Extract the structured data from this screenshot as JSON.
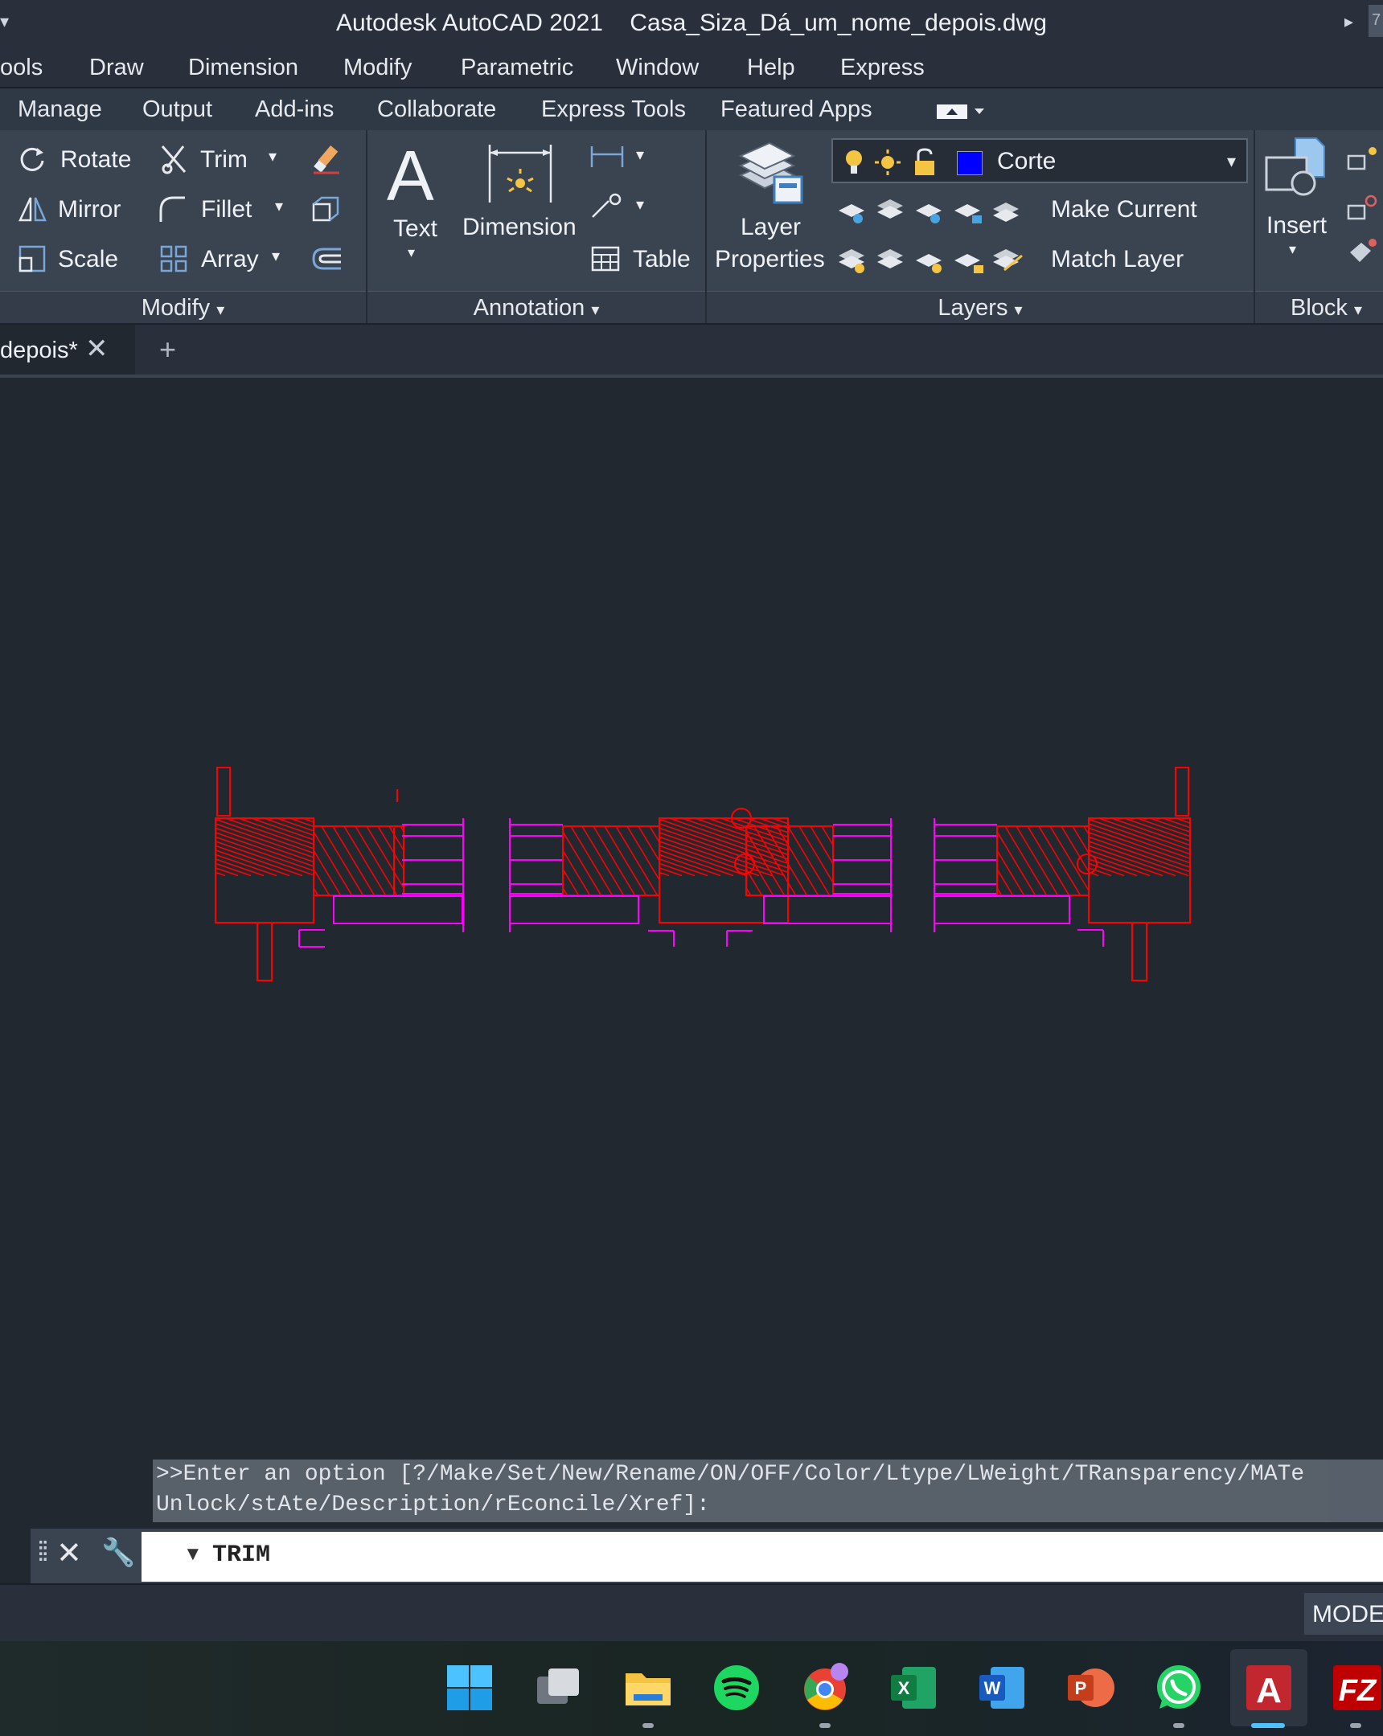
{
  "titlebar": {
    "title": "Autodesk AutoCAD 2021    Casa_Siza_Dá_um_nome_depois.dwg",
    "edge_text": "7"
  },
  "menubar": {
    "items": [
      "ools",
      "Draw",
      "Dimension",
      "Modify",
      "Parametric",
      "Window",
      "Help",
      "Express"
    ]
  },
  "ribbon_tabs": {
    "items": [
      "Manage",
      "Output",
      "Add-ins",
      "Collaborate",
      "Express Tools",
      "Featured Apps"
    ]
  },
  "ribbon": {
    "modify": {
      "rotate": "Rotate",
      "trim": "Trim",
      "mirror": "Mirror",
      "fillet": "Fillet",
      "scale": "Scale",
      "array": "Array",
      "footer": "Modify"
    },
    "annotation": {
      "text": "Text",
      "dimension": "Dimension",
      "table": "Table",
      "footer": "Annotation"
    },
    "layers": {
      "layer_properties_1": "Layer",
      "layer_properties_2": "Properties",
      "current_layer": "Corte",
      "layer_color": "#0000ff",
      "make_current": "Make Current",
      "match_layer": "Match Layer",
      "footer": "Layers"
    },
    "block": {
      "insert": "Insert",
      "footer": "Block"
    }
  },
  "doc_tab": {
    "label": "depois*"
  },
  "command": {
    "history_1": ">>Enter an option [?/Make/Set/New/Rename/ON/OFF/Color/Ltype/LWeight/TRansparency/MATe",
    "history_2": "Unlock/stAte/Description/rEconcile/Xref]:",
    "input_value": "TRIM"
  },
  "status": {
    "model": "MODEL"
  },
  "taskbar": {
    "apps": [
      "start-icon",
      "task-view-icon",
      "file-explorer-icon",
      "spotify-icon",
      "chrome-icon",
      "excel-icon",
      "word-icon",
      "powerpoint-icon",
      "whatsapp-icon",
      "autocad-icon",
      "filezilla-icon"
    ]
  },
  "colors": {
    "drawing_red": "#ff0000",
    "drawing_magenta": "#ff00ff",
    "canvas_bg": "#212830"
  }
}
